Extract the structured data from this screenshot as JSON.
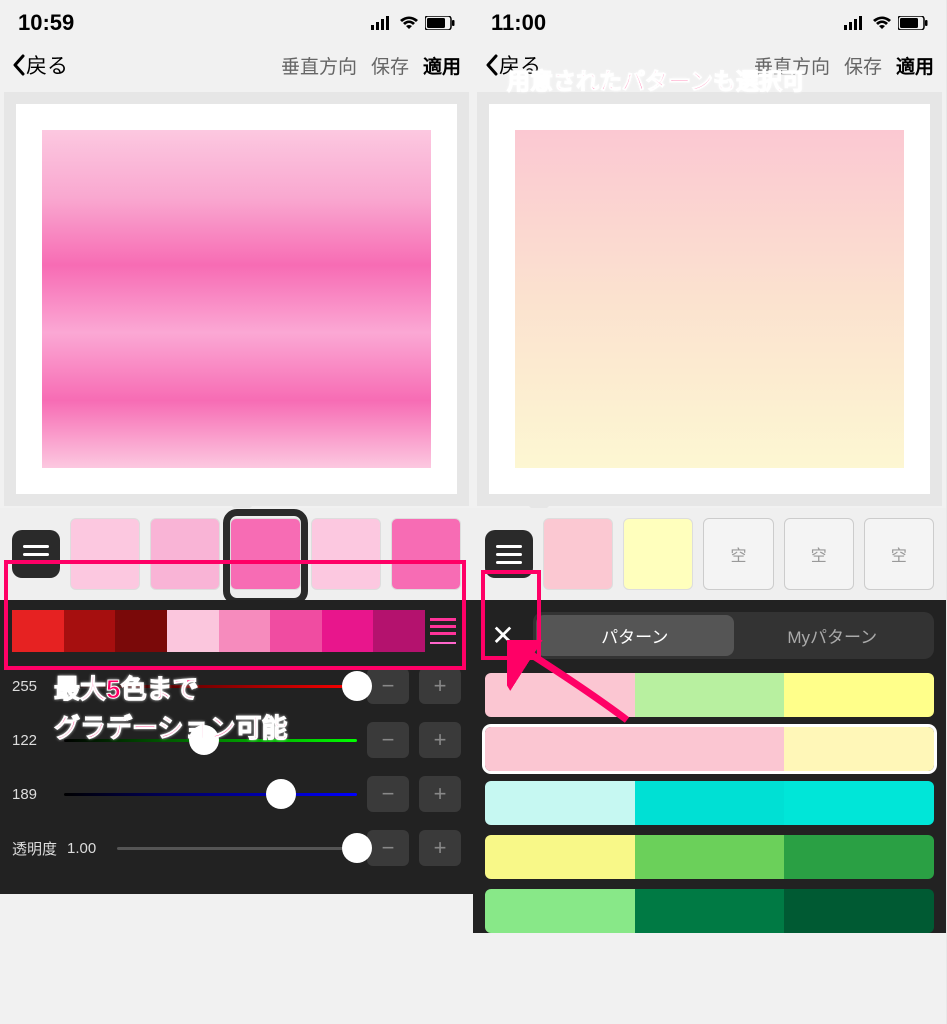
{
  "left": {
    "time": "10:59",
    "back": "戻る",
    "nav": {
      "direction": "垂直方向",
      "save": "保存",
      "apply": "適用"
    },
    "preview_gradient": [
      "#fcc8e0",
      "#f9a8d0",
      "#f76cb4",
      "#fba8d4",
      "#f76cb4",
      "#fcc8e0"
    ],
    "swatches": [
      {
        "color": "#fcc8e0"
      },
      {
        "color": "#f9b4d6"
      },
      {
        "color": "#f76cb4",
        "selected": true
      },
      {
        "color": "#fcc8e0"
      },
      {
        "color": "#f76cb4"
      }
    ],
    "palette": [
      "#e62222",
      "#a60f0f",
      "#7a0909",
      "#fbc6dd",
      "#f68bbd",
      "#f04ca1",
      "#e8168c",
      "#b4126e"
    ],
    "sliders": {
      "r": {
        "value": 255,
        "max": 255
      },
      "g": {
        "value": 122,
        "max": 255
      },
      "b": {
        "value": 189,
        "max": 255
      }
    },
    "opacity": {
      "label": "透明度",
      "value": "1.00"
    },
    "annotation": "最大5色まで\nグラデーション可能"
  },
  "right": {
    "time": "11:00",
    "back": "戻る",
    "nav": {
      "direction": "垂直方向",
      "save": "保存",
      "apply": "適用"
    },
    "preview_gradient": [
      "#fbc8d2",
      "#fbe2cf",
      "#fdf7d2"
    ],
    "swatches": [
      {
        "color": "#fbc8d2"
      },
      {
        "color": "#ffffbd"
      },
      {
        "empty": true,
        "label": "空"
      },
      {
        "empty": true,
        "label": "空"
      },
      {
        "empty": true,
        "label": "空"
      }
    ],
    "tabs": {
      "pattern": "パターン",
      "my": "Myパターン"
    },
    "patterns": [
      [
        "#fbc6d2",
        "#b8f0a0",
        "#ffff8a"
      ],
      [
        "#fbc6d2",
        "#fbc6d2",
        "#fff7b8"
      ],
      [
        "#c6f8f2",
        "#00e0d4",
        "#00e6d8"
      ],
      [
        "#f8f888",
        "#6bd05a",
        "#2aa044"
      ],
      [
        "#88e888",
        "#007a44",
        "#005a33"
      ]
    ],
    "selected_pattern": 1,
    "annotation": "用意されたパターンも選択可"
  }
}
